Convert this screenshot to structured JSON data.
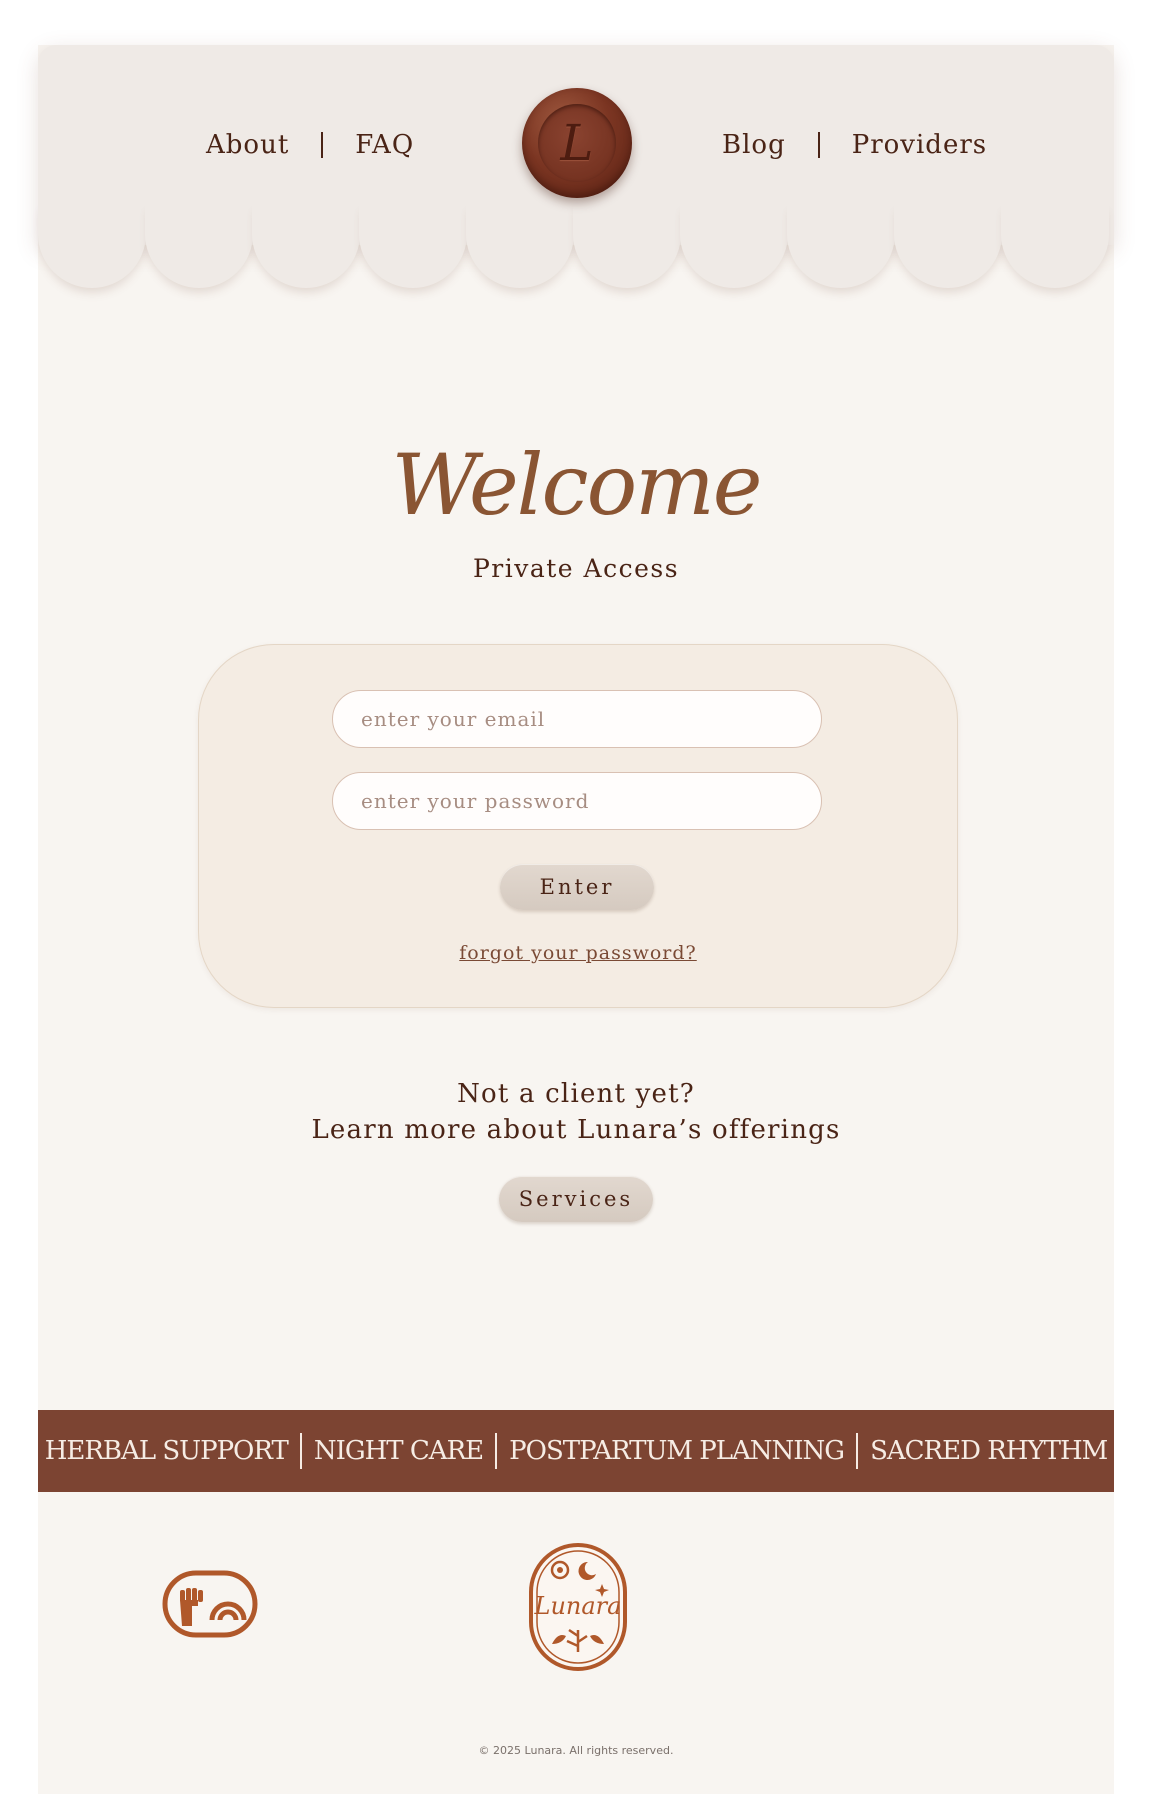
{
  "nav": {
    "about": "About",
    "faq": "FAQ",
    "blog": "Blog",
    "providers": "Providers",
    "seal_letter": "L"
  },
  "hero": {
    "title": "Welcome",
    "subtitle": "Private Access"
  },
  "login": {
    "email_placeholder": "enter your email",
    "password_placeholder": "enter your password",
    "enter_label": "Enter",
    "forgot_label": "forgot your password?"
  },
  "cta": {
    "line1": "Not a client yet?",
    "line2": "Learn more about Lunara’s offerings",
    "services_label": "Services"
  },
  "offerings": [
    "HERBAL SUPPORT",
    "NIGHT CARE",
    "POSTPARTUM PLANNING",
    "SACRED RHYTHM"
  ],
  "footer": {
    "logo_text": "Lunara",
    "copyright": "© 2025 Lunara. All rights reserved."
  },
  "colors": {
    "accent": "#7c4432",
    "seal": "#6d2c1b",
    "text": "#4a2416",
    "page_bg": "#f8f5f1",
    "card_bg": "#f4ece3",
    "icon": "#b0582a"
  },
  "icons": [
    "wax-seal-icon",
    "fist-rainbow-icon",
    "lunara-badge-icon"
  ]
}
